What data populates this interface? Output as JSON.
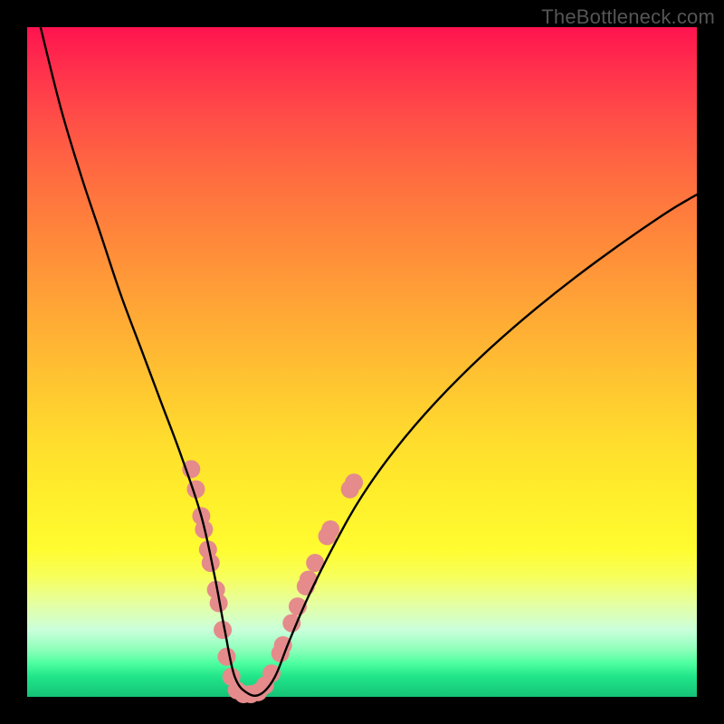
{
  "watermark": "TheBottleneck.com",
  "colors": {
    "frame": "#000000",
    "curve_stroke": "#000000",
    "dot_fill": "#e58b8b",
    "gradient_top": "#ff134f",
    "gradient_bottom": "#15c176"
  },
  "chart_data": {
    "type": "line",
    "title": "",
    "xlabel": "",
    "ylabel": "",
    "xlim": [
      0,
      100
    ],
    "ylim": [
      0,
      100
    ],
    "note": "Smooth V-shaped bottleneck curve on rainbow gradient; y% read top-to-bottom (0% top, ~100% bottom). Axis values are unlabeled estimates.",
    "series": [
      {
        "name": "bottleneck-curve",
        "x": [
          2,
          5,
          8,
          11,
          14,
          17,
          20,
          23,
          26,
          28,
          29.5,
          31,
          33,
          35,
          37,
          39,
          42,
          46,
          50,
          55,
          61,
          68,
          76,
          85,
          95,
          100
        ],
        "y": [
          0,
          12,
          22,
          31,
          40,
          48,
          56,
          64,
          73,
          82,
          90,
          97,
          99.5,
          99.5,
          97,
          92,
          85,
          77,
          70,
          63,
          56,
          49,
          42,
          35,
          28,
          25
        ]
      }
    ],
    "dots": [
      {
        "x": 24.5,
        "y": 66
      },
      {
        "x": 25.2,
        "y": 69
      },
      {
        "x": 26.0,
        "y": 73
      },
      {
        "x": 26.4,
        "y": 75
      },
      {
        "x": 27.0,
        "y": 78
      },
      {
        "x": 27.4,
        "y": 80
      },
      {
        "x": 28.2,
        "y": 84
      },
      {
        "x": 28.6,
        "y": 86
      },
      {
        "x": 29.2,
        "y": 90
      },
      {
        "x": 29.8,
        "y": 94
      },
      {
        "x": 30.5,
        "y": 97
      },
      {
        "x": 31.3,
        "y": 99
      },
      {
        "x": 32.3,
        "y": 99.6
      },
      {
        "x": 33.4,
        "y": 99.6
      },
      {
        "x": 34.5,
        "y": 99.3
      },
      {
        "x": 35.5,
        "y": 98.3
      },
      {
        "x": 36.5,
        "y": 96.5
      },
      {
        "x": 37.8,
        "y": 93.5
      },
      {
        "x": 38.2,
        "y": 92.3
      },
      {
        "x": 39.5,
        "y": 89
      },
      {
        "x": 40.4,
        "y": 86.5
      },
      {
        "x": 41.6,
        "y": 83.5
      },
      {
        "x": 42.0,
        "y": 82.5
      },
      {
        "x": 43.0,
        "y": 80
      },
      {
        "x": 44.8,
        "y": 76
      },
      {
        "x": 45.3,
        "y": 75
      },
      {
        "x": 48.2,
        "y": 69
      },
      {
        "x": 48.8,
        "y": 68
      }
    ],
    "dot_radius_px": 10
  }
}
